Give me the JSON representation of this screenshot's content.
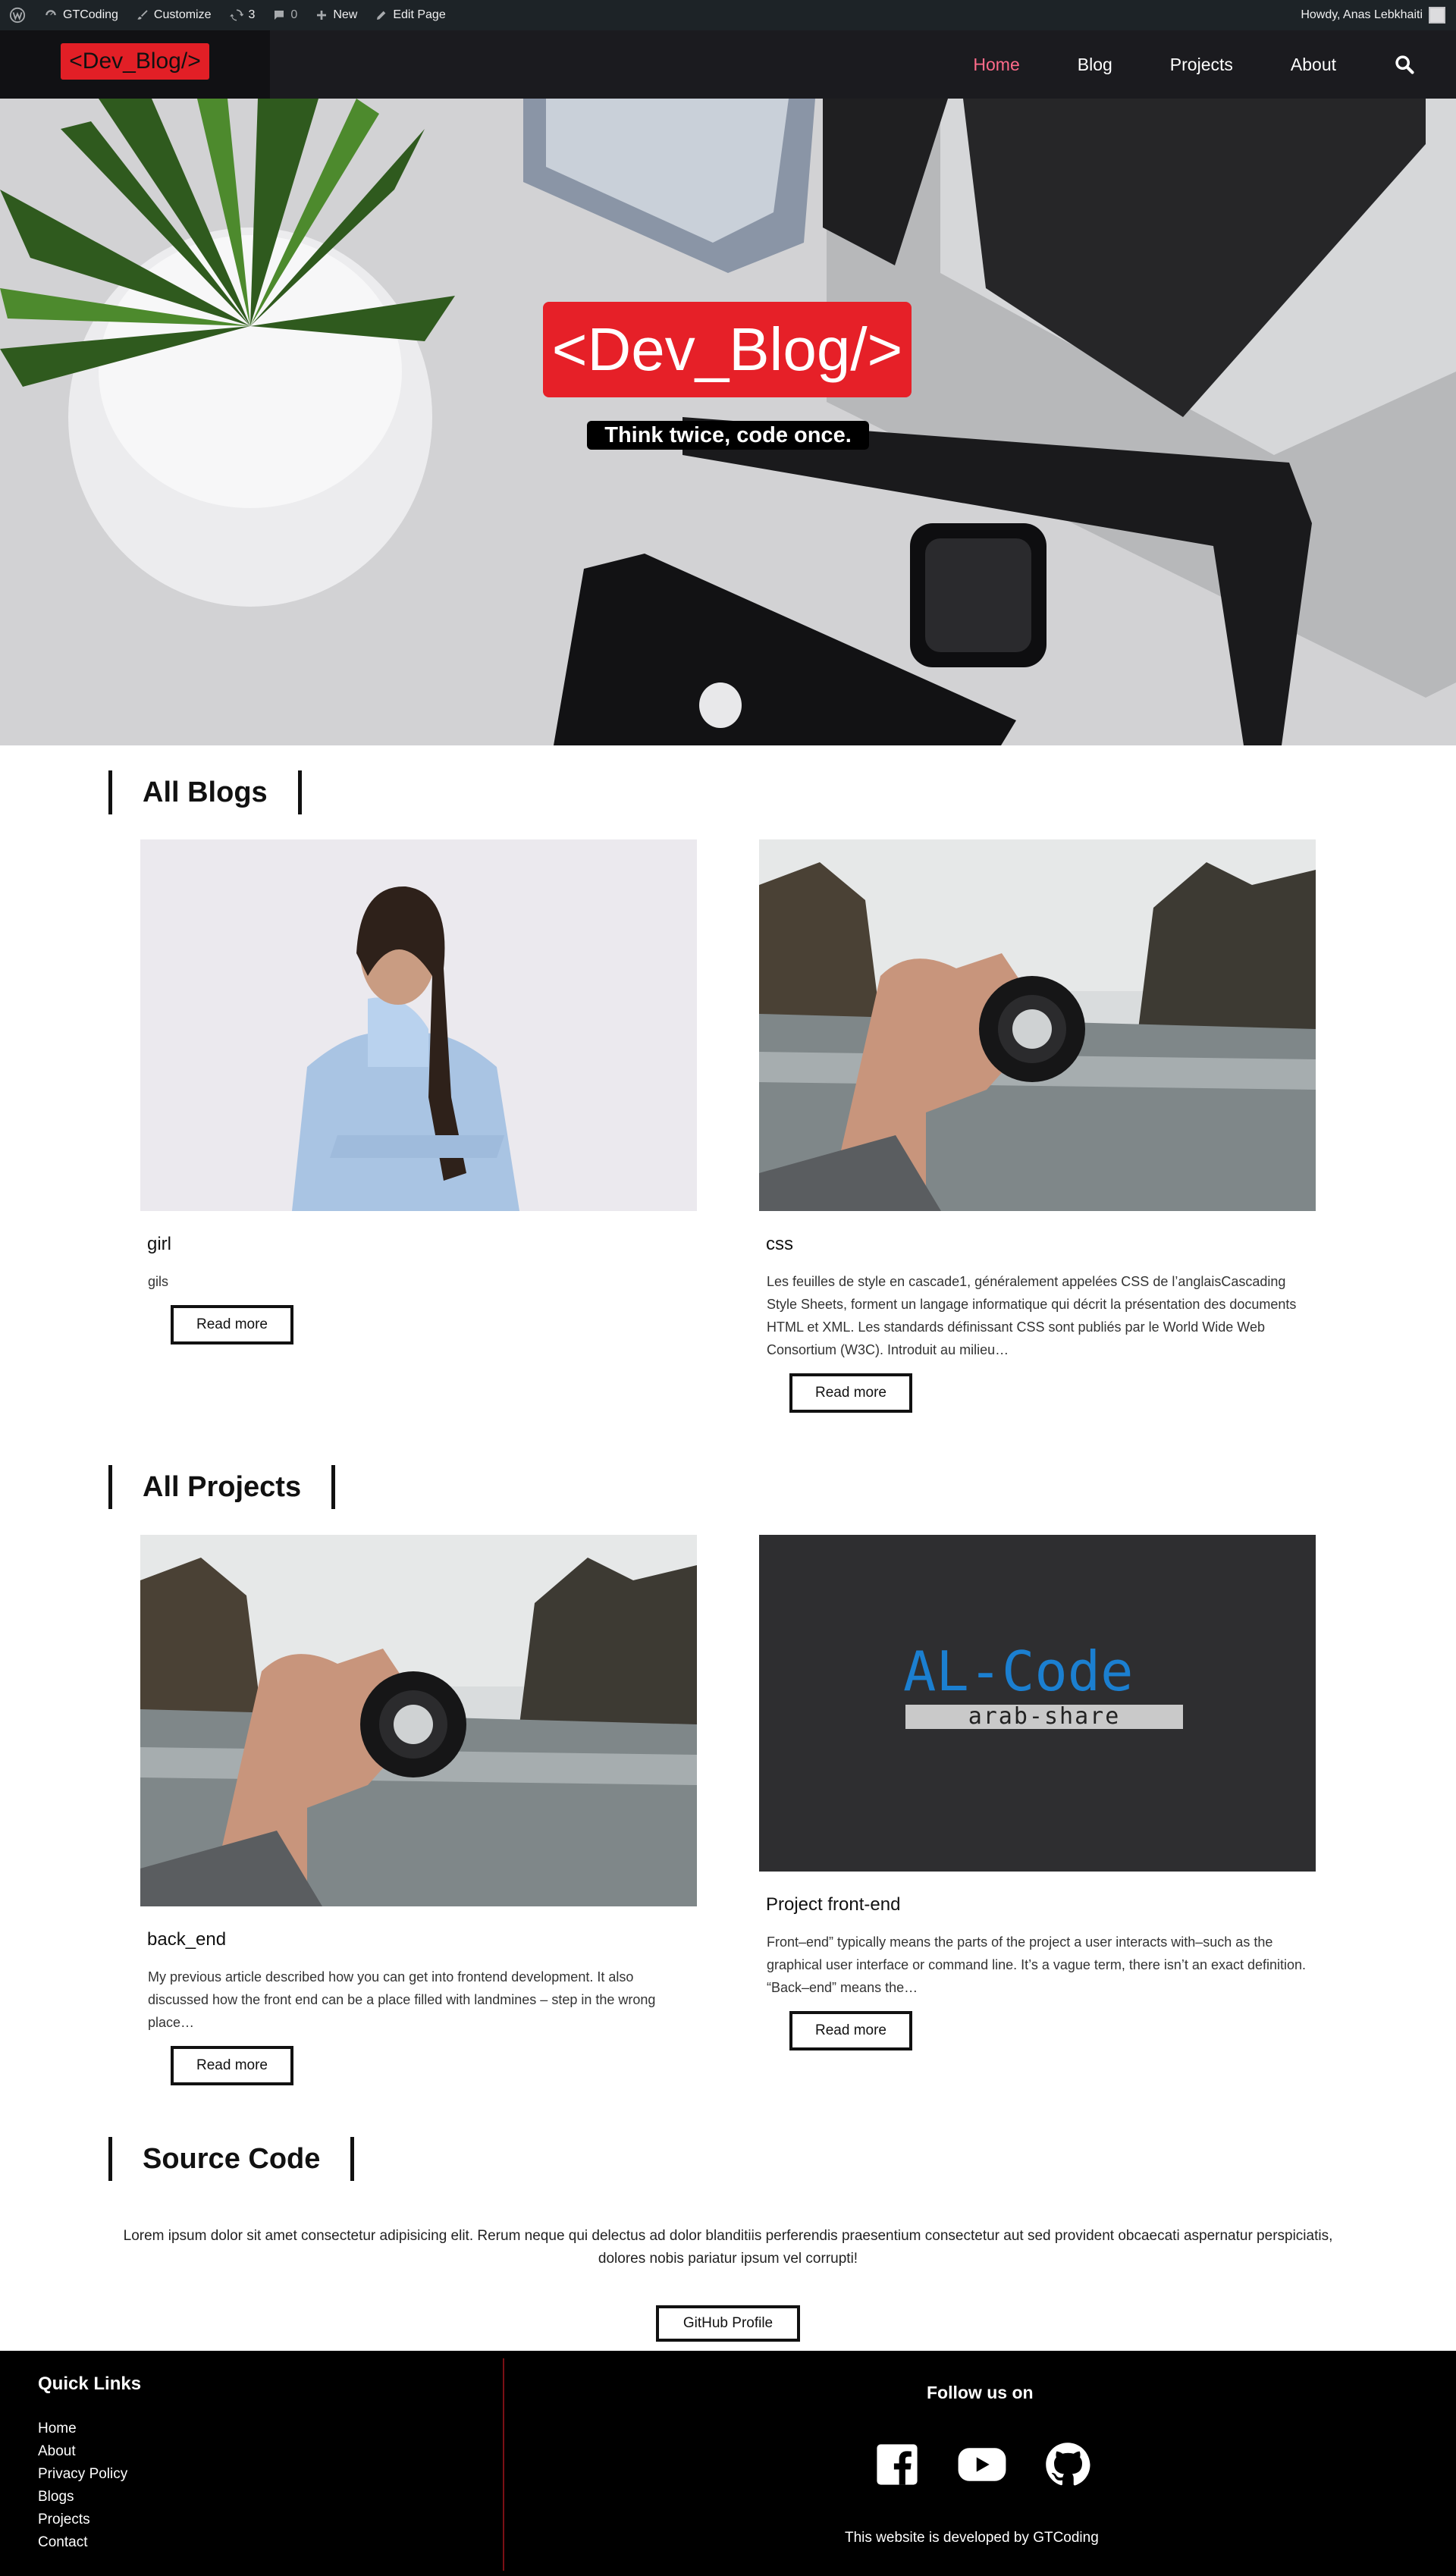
{
  "admin_bar": {
    "site_name": "GTCoding",
    "customize": "Customize",
    "updates_count": "3",
    "comments_count": "0",
    "new_label": "New",
    "edit_page": "Edit Page",
    "greeting": "Howdy, Anas Lebkhaiti"
  },
  "header": {
    "logo_text": "<Dev_Blog/>",
    "nav": [
      "Home",
      "Blog",
      "Projects",
      "About"
    ],
    "active_nav": "Home"
  },
  "hero": {
    "title": "<Dev_Blog/>",
    "tagline": "Think twice, code once."
  },
  "blogs": {
    "heading": "All Blogs",
    "items": [
      {
        "title": "girl",
        "excerpt": "gils",
        "button": "Read more"
      },
      {
        "title": "css",
        "excerpt": "Les feuilles de style en cascade1, généralement appelées CSS de l’anglaisCascading Style Sheets, forment un langage informatique qui décrit la présentation des documents HTML et XML. Les standards définissant CSS sont publiés par le World Wide Web Consortium (W3C). Introduit au milieu…",
        "button": "Read more"
      }
    ]
  },
  "projects": {
    "heading": "All Projects",
    "items": [
      {
        "title": "back_end",
        "excerpt": "My previous article described how you can get into frontend development. It also discussed how the front end can be a place filled with landmines – step in the wrong place…",
        "button": "Read more"
      },
      {
        "title": "Project front-end",
        "excerpt": "Front–end” typically means the parts of the project a user interacts with–such as the graphical user interface or command line. It’s a vague term, there isn’t an exact definition. “Back–end” means the…",
        "button": "Read more",
        "image_text": {
          "logo": "AL-Code",
          "sub": "arab-share"
        }
      }
    ]
  },
  "source": {
    "heading": "Source Code",
    "text": "Lorem ipsum dolor sit amet consectetur adipisicing elit. Rerum neque qui delectus ad dolor blanditiis perferendis praesentium consectetur aut sed provident obcaecati aspernatur perspiciatis, dolores nobis pariatur ipsum vel corrupti!",
    "button": "GitHub Profile"
  },
  "footer": {
    "quick_links_title": "Quick Links",
    "quick_links": [
      "Home",
      "About",
      "Privacy Policy",
      "Blogs",
      "Projects",
      "Contact"
    ],
    "follow_title": "Follow us on",
    "socials": [
      "facebook-icon",
      "youtube-icon",
      "github-icon"
    ],
    "credit": "This website is developed by GTCoding"
  },
  "colors": {
    "accent_red": "#e21f26",
    "active_nav": "#ff6b8a",
    "header_bg": "#1b1b1f",
    "adminbar_bg": "#1d2327"
  }
}
